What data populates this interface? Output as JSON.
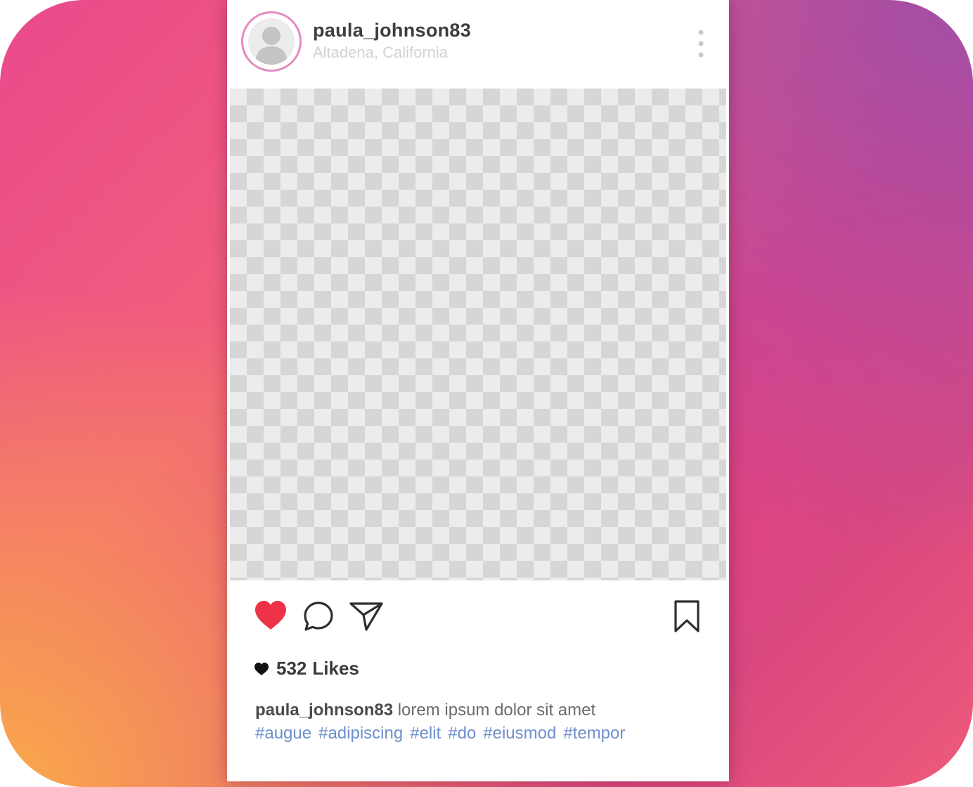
{
  "post": {
    "username": "paula_johnson83",
    "location": "Altadena, California",
    "likes_count": "532",
    "likes_label": "Likes",
    "caption_user": "paula_johnson83",
    "caption_text": "lorem ipsum dolor sit amet",
    "hashtags": [
      "#augue",
      "#adipiscing",
      "#elit",
      "#do",
      "#eiusmod",
      "#tempor"
    ]
  },
  "icons": {
    "avatar": "user-silhouette-icon",
    "more": "more-vertical-icon",
    "like": "heart-icon",
    "comment": "comment-bubble-icon",
    "share": "paper-plane-icon",
    "save": "bookmark-icon",
    "likes_marker": "heart-small-icon"
  },
  "colors": {
    "like_active": "#ee3348",
    "hashtag": "#6d8fcc",
    "avatar_ring": "#e58bc0",
    "gradient_start": "#f9a94a",
    "gradient_mid": "#e94a8c",
    "gradient_end": "#a24fa6"
  }
}
